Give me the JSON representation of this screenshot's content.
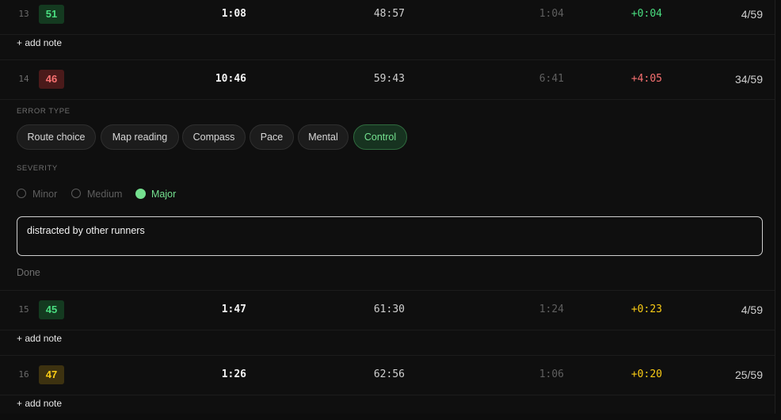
{
  "colors": {
    "good": "#4ade80",
    "bad": "#f87171",
    "warn": "#facc15"
  },
  "rows": [
    {
      "index": "13",
      "control": "51",
      "control_color": "green",
      "split": "1:08",
      "cumulative": "48:57",
      "best": "1:04",
      "loss": "+0:04",
      "loss_color": "green",
      "rank": "4/59"
    },
    {
      "index": "14",
      "control": "46",
      "control_color": "red",
      "split": "10:46",
      "cumulative": "59:43",
      "best": "6:41",
      "loss": "+4:05",
      "loss_color": "red",
      "rank": "34/59"
    },
    {
      "index": "15",
      "control": "45",
      "control_color": "green",
      "split": "1:47",
      "cumulative": "61:30",
      "best": "1:24",
      "loss": "+0:23",
      "loss_color": "yellow",
      "rank": "4/59"
    },
    {
      "index": "16",
      "control": "47",
      "control_color": "yellow",
      "split": "1:26",
      "cumulative": "62:56",
      "best": "1:06",
      "loss": "+0:20",
      "loss_color": "yellow",
      "rank": "25/59"
    }
  ],
  "add_note_label": "+ add note",
  "editor": {
    "error_type_label": "ERROR TYPE",
    "error_types": [
      "Route choice",
      "Map reading",
      "Compass",
      "Pace",
      "Mental",
      "Control"
    ],
    "selected_error_type": "Control",
    "severity_label": "SEVERITY",
    "severities": [
      "Minor",
      "Medium",
      "Major"
    ],
    "selected_severity": "Major",
    "note_text": "distracted by other runners",
    "done_label": "Done"
  }
}
